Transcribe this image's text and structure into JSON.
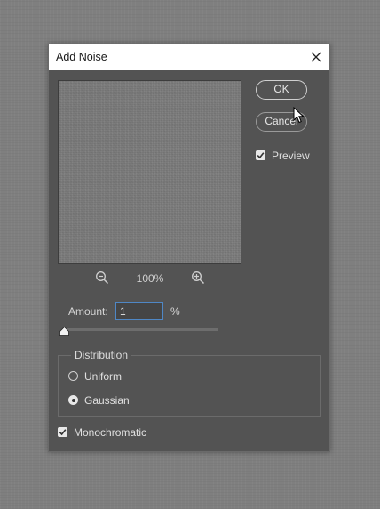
{
  "dialog": {
    "title": "Add Noise",
    "ok_label": "OK",
    "cancel_label": "Cancel",
    "preview_label": "Preview",
    "preview_checked": true,
    "zoom_level": "100%"
  },
  "amount": {
    "label": "Amount:",
    "value": "1",
    "unit": "%",
    "slider_fraction": 0.0025
  },
  "distribution": {
    "legend": "Distribution",
    "options": [
      {
        "label": "Uniform",
        "selected": false
      },
      {
        "label": "Gaussian",
        "selected": true
      }
    ]
  },
  "monochromatic": {
    "label": "Monochromatic",
    "checked": true
  },
  "icons": {
    "close": "close-icon",
    "zoom_out": "zoom-out-icon",
    "zoom_in": "zoom-in-icon",
    "cursor": "mouse-pointer-icon"
  }
}
